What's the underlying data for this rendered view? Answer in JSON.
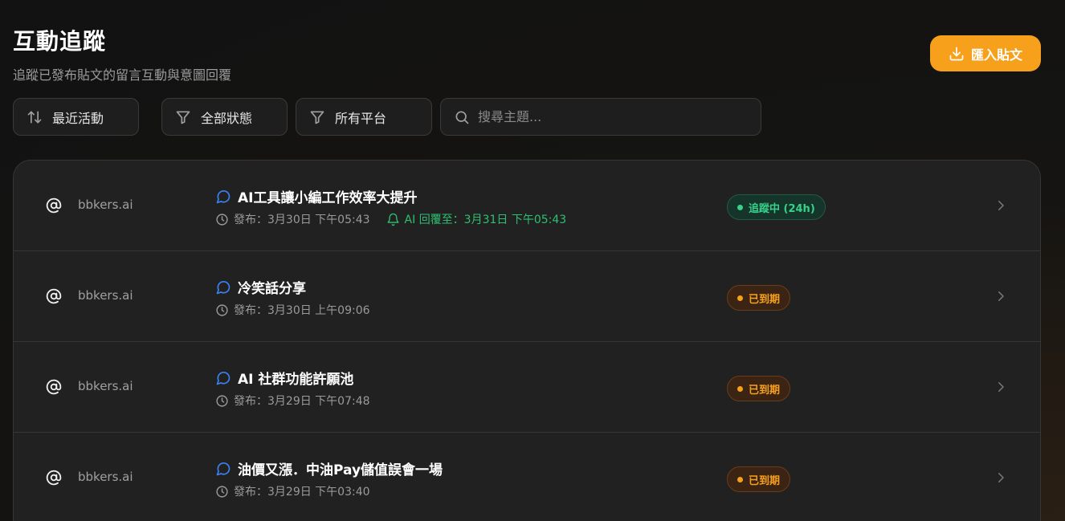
{
  "header": {
    "title": "互動追蹤",
    "subtitle": "追蹤已發布貼文的留言互動與意圖回覆",
    "import_label": "匯入貼文"
  },
  "filters": {
    "sort_label": "最近活動",
    "status_label": "全部狀態",
    "platform_label": "所有平台",
    "search_placeholder": "搜尋主題..."
  },
  "posts": [
    {
      "account": "bbkers.ai",
      "title": "AI工具讓小編工作效率大提升",
      "published": "發布：3月30日 下午05:43",
      "ai_reply": "AI 回覆至：3月31日 下午05:43",
      "status": "追蹤中 (24h)",
      "status_type": "active"
    },
    {
      "account": "bbkers.ai",
      "title": "冷笑話分享",
      "published": "發布：3月30日 上午09:06",
      "status": "已到期",
      "status_type": "expired"
    },
    {
      "account": "bbkers.ai",
      "title": "AI 社群功能許願池",
      "published": "發布：3月29日 下午07:48",
      "status": "已到期",
      "status_type": "expired"
    },
    {
      "account": "bbkers.ai",
      "title": "油價又漲．中油Pay儲值誤會一場",
      "published": "發布：3月29日 下午03:40",
      "status": "已到期",
      "status_type": "expired"
    }
  ],
  "colors": {
    "accent": "#f7a01c",
    "active": "#36d18a",
    "chat_icon": "#3b82f6"
  },
  "icons": {
    "import": "download-icon",
    "sort": "sort-arrows-icon",
    "filter": "funnel-icon",
    "search": "search-icon",
    "account": "at-sign-icon",
    "post": "chat-bubble-icon",
    "time": "clock-icon",
    "reply": "bell-icon",
    "open": "chevron-right-icon"
  }
}
